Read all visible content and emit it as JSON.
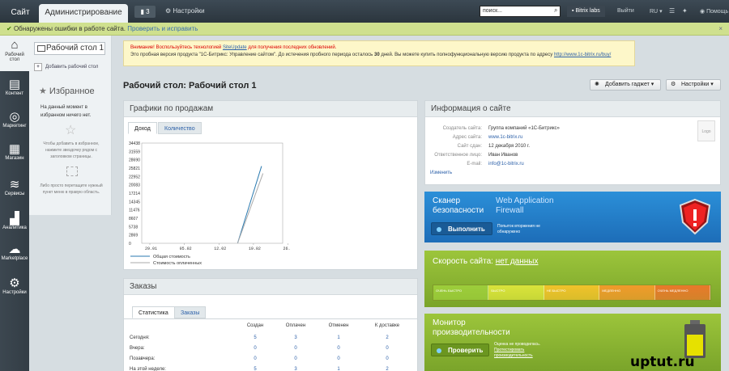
{
  "topbar": {
    "site_tab": "Сайт",
    "admin_tab": "Администрирование",
    "notif_count": "3",
    "settings": "Настройки",
    "search_placeholder": "поиск...",
    "user": "Bitrix labs",
    "logout": "Выйти",
    "lang": "RU",
    "help": "Помощь"
  },
  "error_bar": {
    "text": "Обнаружены ошибки в работе сайта.",
    "fix_link": "Проверить и исправить",
    "close": "×"
  },
  "nav": [
    {
      "icon": "desktop-icon",
      "label": "Рабочий стол"
    },
    {
      "icon": "document-icon",
      "label": "Контент"
    },
    {
      "icon": "target-icon",
      "label": "Маркетинг"
    },
    {
      "icon": "cart-icon",
      "label": "Магазин"
    },
    {
      "icon": "layers-icon",
      "label": "Сервисы"
    },
    {
      "icon": "chart-icon",
      "label": "Аналитика"
    },
    {
      "icon": "cloud-icon",
      "label": "Marketplace"
    },
    {
      "icon": "gear-icon",
      "label": "Настройки"
    }
  ],
  "side": {
    "desktop_btn": "Рабочий стол 1",
    "add_desktop": "Добавить рабочий стол",
    "favorites": "Избранное",
    "fav_empty": "На данный момент в избранном ничего нет.",
    "fav_hint1": "Чтобы добавить в избранное, нажмите звездочку рядом с заголовком страницы.",
    "fav_hint2": "Либо просто перетащите нужный пункт меню в правую область."
  },
  "trial": {
    "warn": "Внимание! Воспользуйтесь технологией",
    "siteupdate": "SiteUpdate",
    "warn2": "для получения последних обновлений.",
    "line2a": "Это пробная версия продукта \"1С-Битрикс: Управление сайтом\". До истечения пробного периода осталось",
    "days": "30",
    "line2b": "дней. Вы можете купить полнофункциональную версию продукта по адресу",
    "url": "http://www.1c-bitrix.ru/buy/"
  },
  "page_title": "Рабочий стол: Рабочий стол 1",
  "buttons": {
    "add_gadget": "Добавить гаджет",
    "settings": "Настройки"
  },
  "sales": {
    "title": "Графики по продажам",
    "tab1": "Доход",
    "tab2": "Количество",
    "legend1": "Общая стоимость",
    "legend2": "Стоимость оплаченных",
    "color1": "#2a7ab0",
    "color2": "#aaaaaa"
  },
  "chart_data": {
    "type": "line",
    "yticks": [
      "34438",
      "31559",
      "28690",
      "25821",
      "22952",
      "20083",
      "17214",
      "14345",
      "11476",
      "8607",
      "5738",
      "2869",
      "0"
    ],
    "xticks": [
      "29.01",
      "05.02",
      "12.02",
      "19.02",
      "26."
    ],
    "ylim": [
      0,
      34438
    ],
    "series": [
      {
        "name": "Общая стоимость",
        "x": [
          0.68,
          0.85
        ],
        "values": [
          0,
          26500
        ]
      },
      {
        "name": "Стоимость оплаченных",
        "x": [
          0.68,
          0.86
        ],
        "values": [
          0,
          24000
        ]
      }
    ]
  },
  "orders": {
    "title": "Заказы",
    "tab1": "Статистика",
    "tab2": "Заказы",
    "headers": [
      "Создан",
      "Оплачен",
      "Отменен",
      "К доставке"
    ],
    "rows": [
      {
        "label": "Сегодня:",
        "v": [
          "5",
          "3",
          "1",
          "2"
        ]
      },
      {
        "label": "Вчера:",
        "v": [
          "0",
          "0",
          "0",
          "0"
        ]
      },
      {
        "label": "Позавчера:",
        "v": [
          "0",
          "0",
          "0",
          "0"
        ]
      },
      {
        "label": "На этой неделе:",
        "v": [
          "5",
          "3",
          "1",
          "2"
        ]
      }
    ]
  },
  "info": {
    "title": "Информация о сайте",
    "rows": [
      {
        "l": "Создатель сайта:",
        "v": "Группа компаний «1С-Битрикс»"
      },
      {
        "l": "Адрес сайта:",
        "v": "www.1c-bitrix.ru"
      },
      {
        "l": "Сайт сдан:",
        "v": "12 декабря 2010 г."
      },
      {
        "l": "Ответственное лицо:",
        "v": "Иван Иванов"
      },
      {
        "l": "E-mail:",
        "v": "info@1c-bitrix.ru"
      }
    ],
    "edit": "Изменить",
    "logo": "Logo"
  },
  "scanner": {
    "title": "Сканер безопасности",
    "waf": "Web Application Firewall",
    "run": "Выполнить",
    "note": "Попыток вторжения не обнаружено"
  },
  "speed": {
    "title": "Скорость сайта:",
    "value": "нет данных",
    "segments": [
      "ОЧЕНЬ БЫСТРО",
      "БЫСТРО",
      "НЕ БЫСТРО",
      "МЕДЛЕННО",
      "ОЧЕНЬ МЕДЛЕННО"
    ]
  },
  "perf": {
    "title": "Монитор производительности",
    "check": "Проверить",
    "note": "Оценка не проводилась.",
    "link": "Протестировать производительность"
  },
  "watermark": "uptut.ru"
}
